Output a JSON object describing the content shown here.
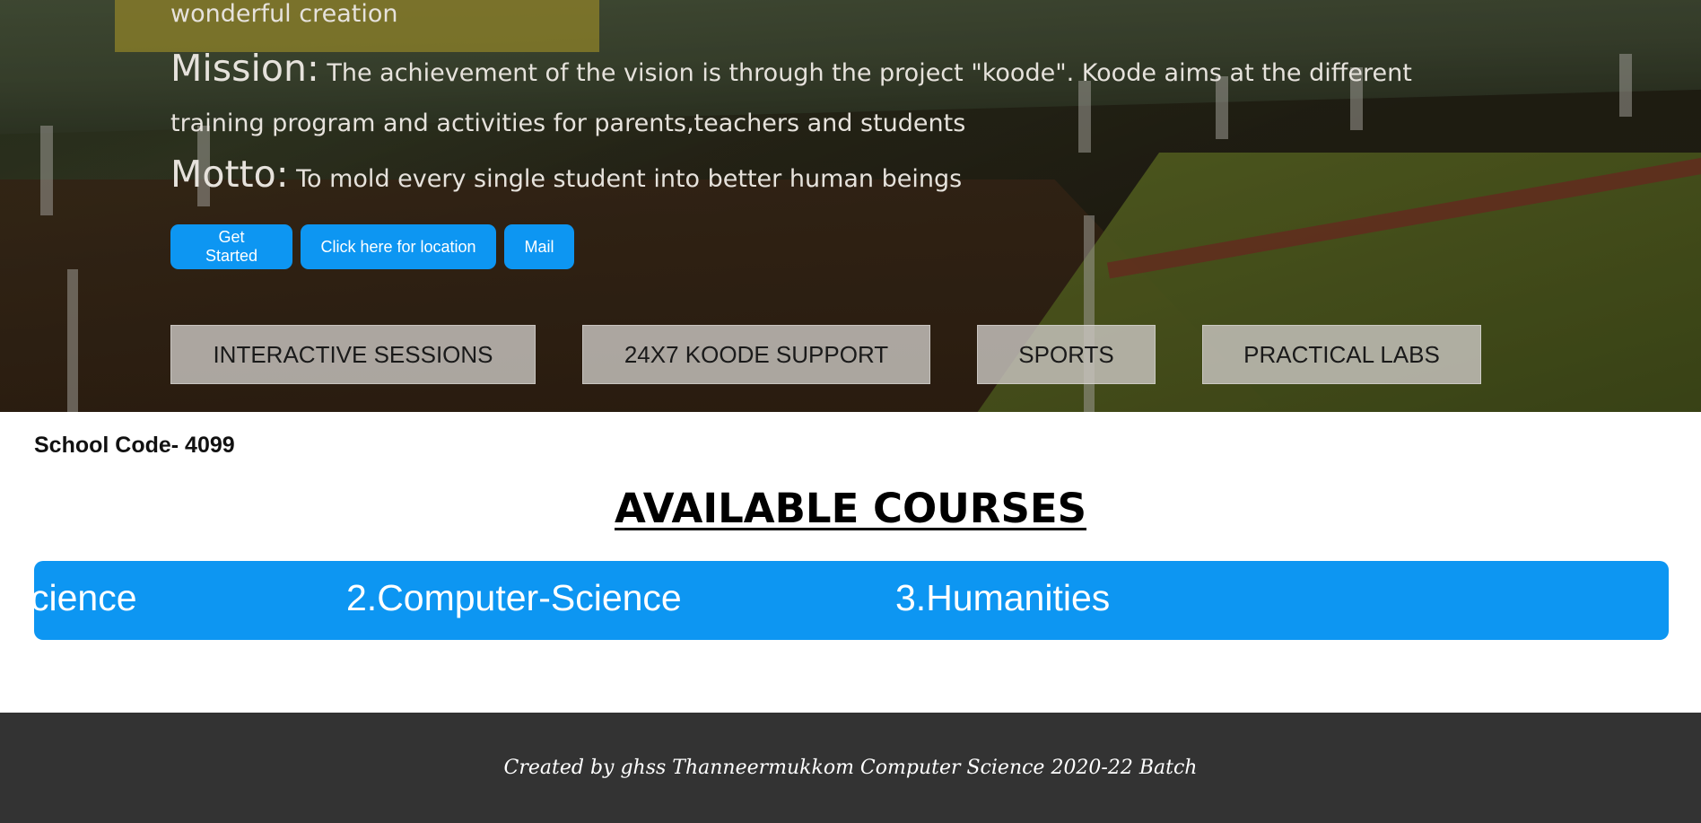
{
  "hero": {
    "vision_tail": "wonderful creation",
    "mission_label": "Mission:",
    "mission_text": "The achievement of the vision is through the project \"koode\". Koode aims at the different training program and activities for parents,teachers and students",
    "motto_label": "Motto:",
    "motto_text": "To mold every single student into better human beings",
    "buttons": {
      "get_started": "Get Started",
      "location": "Click here for location",
      "mail": "Mail"
    },
    "features": [
      "INTERACTIVE SESSIONS",
      "24X7 KOODE SUPPORT",
      "SPORTS",
      "PRACTICAL LABS"
    ]
  },
  "school_code": "School Code- 4099",
  "courses": {
    "title": "AVAILABLE COURSES",
    "items": [
      "cience",
      "2.Computer-Science",
      "3.Humanities"
    ]
  },
  "footer": {
    "text": "Created by ghss Thanneermukkom Computer Science 2020-22 Batch"
  },
  "colors": {
    "accent_blue": "#0d96f2",
    "footer_bg": "#333333",
    "feature_box_bg": "#c8c4c0"
  }
}
